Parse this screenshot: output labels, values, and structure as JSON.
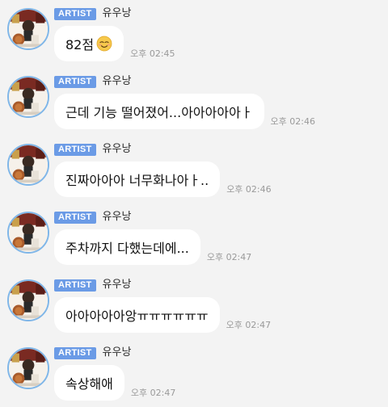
{
  "sender": {
    "badge": "ARTIST",
    "name": "유우낭"
  },
  "messages": [
    {
      "text": "82점",
      "emoji": "relieved-smile-emoji",
      "time": "오후 02:45"
    },
    {
      "text": "근데 기능 떨어졌어...아아아아아ㅏ",
      "time": "오후 02:46"
    },
    {
      "text": "진짜아아아 너무화나아ㅏ..",
      "time": "오후 02:46"
    },
    {
      "text": "주차까지 다했는데에...",
      "time": "오후 02:47"
    },
    {
      "text": "아아아아아앙ㅠㅠㅠㅠㅠㅠ",
      "time": "오후 02:47"
    },
    {
      "text": "속상해애",
      "time": "오후 02:47"
    }
  ]
}
